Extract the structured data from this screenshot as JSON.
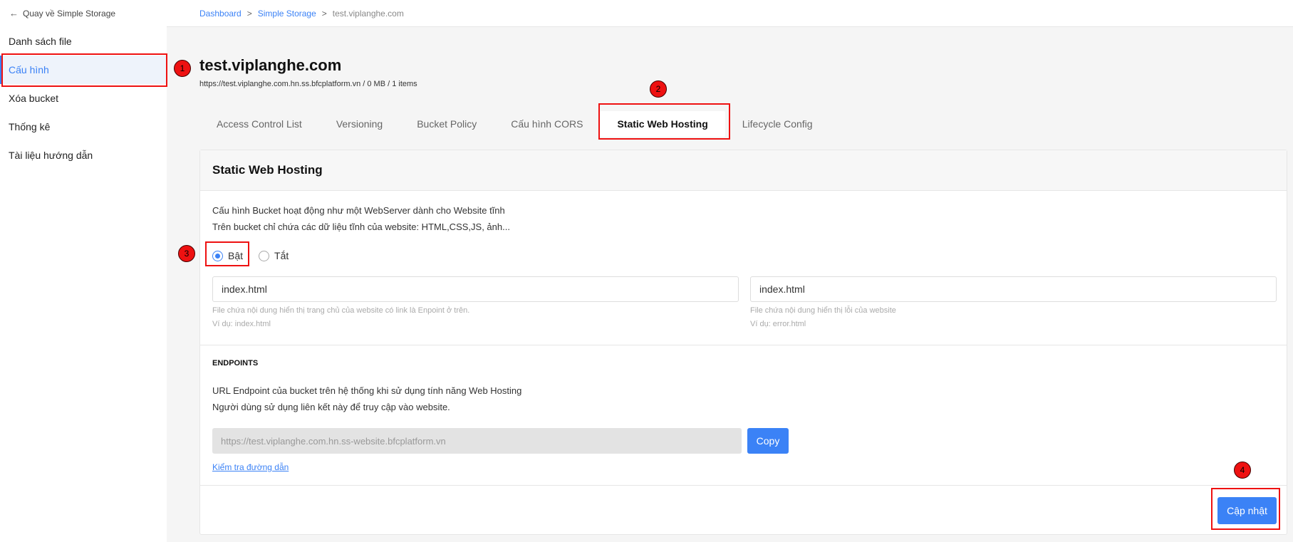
{
  "sidebar": {
    "back_label": "Quay về Simple Storage",
    "items": [
      {
        "label": "Danh sách file",
        "active": false
      },
      {
        "label": "Cấu hình",
        "active": true
      },
      {
        "label": "Xóa bucket",
        "active": false
      },
      {
        "label": "Thống kê",
        "active": false
      },
      {
        "label": "Tài liệu hướng dẫn",
        "active": false
      }
    ]
  },
  "breadcrumb": {
    "items": [
      "Dashboard",
      "Simple Storage",
      "test.viplanghe.com"
    ],
    "separator": ">"
  },
  "page": {
    "title": "test.viplanghe.com",
    "subtitle": "https://test.viplanghe.com.hn.ss.bfcplatform.vn / 0 MB / 1 items"
  },
  "tabs": [
    {
      "label": "Access Control List",
      "active": false
    },
    {
      "label": "Versioning",
      "active": false
    },
    {
      "label": "Bucket Policy",
      "active": false
    },
    {
      "label": "Cấu hình CORS",
      "active": false
    },
    {
      "label": "Static Web Hosting",
      "active": true
    },
    {
      "label": "Lifecycle Config",
      "active": false
    }
  ],
  "card": {
    "title": "Static Web Hosting",
    "desc_line1": "Cấu hình Bucket hoạt động như một WebServer dành cho Website tĩnh",
    "desc_line2": "Trên bucket chỉ chứa các dữ liệu tĩnh của website: HTML,CSS,JS, ảnh...",
    "radio_on": "Bật",
    "radio_off": "Tắt",
    "radio_selected": "on",
    "index_value": "index.html",
    "index_hint1": "File chứa nội dung hiển thị trang chủ của website có link là Enpoint ở trên.",
    "index_hint2": "Ví dụ: index.html",
    "error_value": "index.html",
    "error_hint1": "File chứa nội dung hiển thị lỗi của website",
    "error_hint2": "Ví dụ: error.html",
    "endpoints_label": "ENDPOINTS",
    "endpoints_desc1": "URL Endpoint của bucket trên hệ thống khi sử dụng tính năng Web Hosting",
    "endpoints_desc2": "Người dùng sử dụng liên kết này để truy cập vào website.",
    "endpoint_url": "https://test.viplanghe.com.hn.ss-website.bfcplatform.vn",
    "copy_label": "Copy",
    "check_link": "Kiểm tra đường dẫn",
    "update_label": "Cập nhật"
  },
  "annotations": [
    "1",
    "2",
    "3",
    "4"
  ],
  "colors": {
    "accent": "#3b82f6",
    "annotation": "#ee1111"
  }
}
